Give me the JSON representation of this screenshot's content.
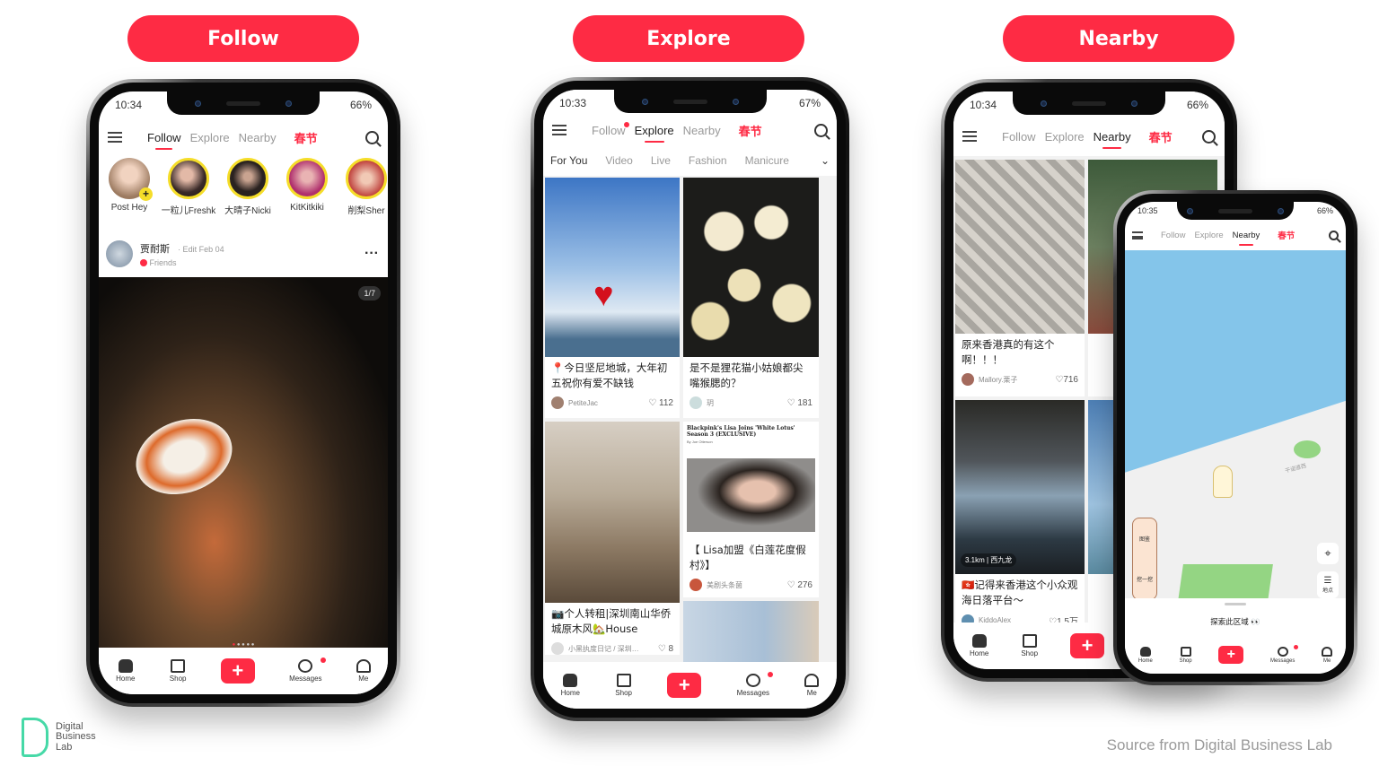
{
  "labels": {
    "follow": "Follow",
    "explore": "Explore",
    "nearby": "Nearby"
  },
  "nav": {
    "tabs": [
      "Follow",
      "Explore",
      "Nearby"
    ],
    "festival": "春节"
  },
  "bottom_nav": [
    "Home",
    "Shop",
    "+",
    "Messages",
    "Me"
  ],
  "phone1": {
    "time": "10:34",
    "battery": "66%",
    "active_tab": "Follow",
    "stories": [
      {
        "name": "Post Hey",
        "self": true
      },
      {
        "name": "一粒儿Freshk"
      },
      {
        "name": "大晴子Nicki"
      },
      {
        "name": "KitKitkiki"
      },
      {
        "name": "削梨Sher"
      }
    ],
    "post": {
      "author": "贾耐斯",
      "edited": "· Edit Feb 04",
      "relation": "Friends",
      "counter": "1/7",
      "more": "···"
    }
  },
  "phone2": {
    "time": "10:33",
    "battery": "67%",
    "active_tab": "Explore",
    "channels": [
      "For You",
      "Video",
      "Live",
      "Fashion",
      "Manicure"
    ],
    "cards": [
      {
        "title": "📍今日坚尼地城，大年初五祝你有爱不缺钱",
        "author": "PetiteJac",
        "likes": "112"
      },
      {
        "title": "是不是狸花猫小姑娘都尖嘴猴腮的？",
        "author": "玥",
        "likes": "181"
      },
      {
        "title": "📷个人转租|深圳南山华侨城原木风🏡House",
        "author": "小黑执度日记 / 深圳…",
        "likes": "8"
      },
      {
        "headline": "Blackpink's Lisa Joins 'White Lotus' Season 3 (EXCLUSIVE)",
        "byline": "By Joe Otterson",
        "title": "【 Lisa加盟《白莲花度假村》】",
        "author": "美剧头条菌",
        "likes": "276"
      }
    ]
  },
  "phone3": {
    "time": "10:34",
    "battery": "66%",
    "active_tab": "Nearby",
    "cards": [
      {
        "title": "原来香港真的有这个啊！！！",
        "author": "Mallory.栗子",
        "likes": "716"
      },
      {
        "title": "🇭🇰记得来香港这个小众观海日落平台～",
        "author": "KiddoAlex",
        "likes": "1.5万",
        "distance": "3.1km | 西九龙"
      }
    ]
  },
  "phone4": {
    "time": "10:35",
    "battery": "66%",
    "active_tab": "Nearby",
    "map_road": "干诺道西",
    "map_buttons": [
      "图鉴",
      "挖一挖"
    ],
    "list_button": "地点",
    "explore_area": "探索此区域 👀"
  },
  "footer": {
    "brand": [
      "Digital",
      "Business",
      "Lab"
    ],
    "source": "Source from Digital Business Lab"
  },
  "colors": {
    "accent": "#fe2b44",
    "story_ring": "#f5dd29",
    "brand": "#46d9a7",
    "water": "#84c5ea",
    "park": "#94d583"
  }
}
